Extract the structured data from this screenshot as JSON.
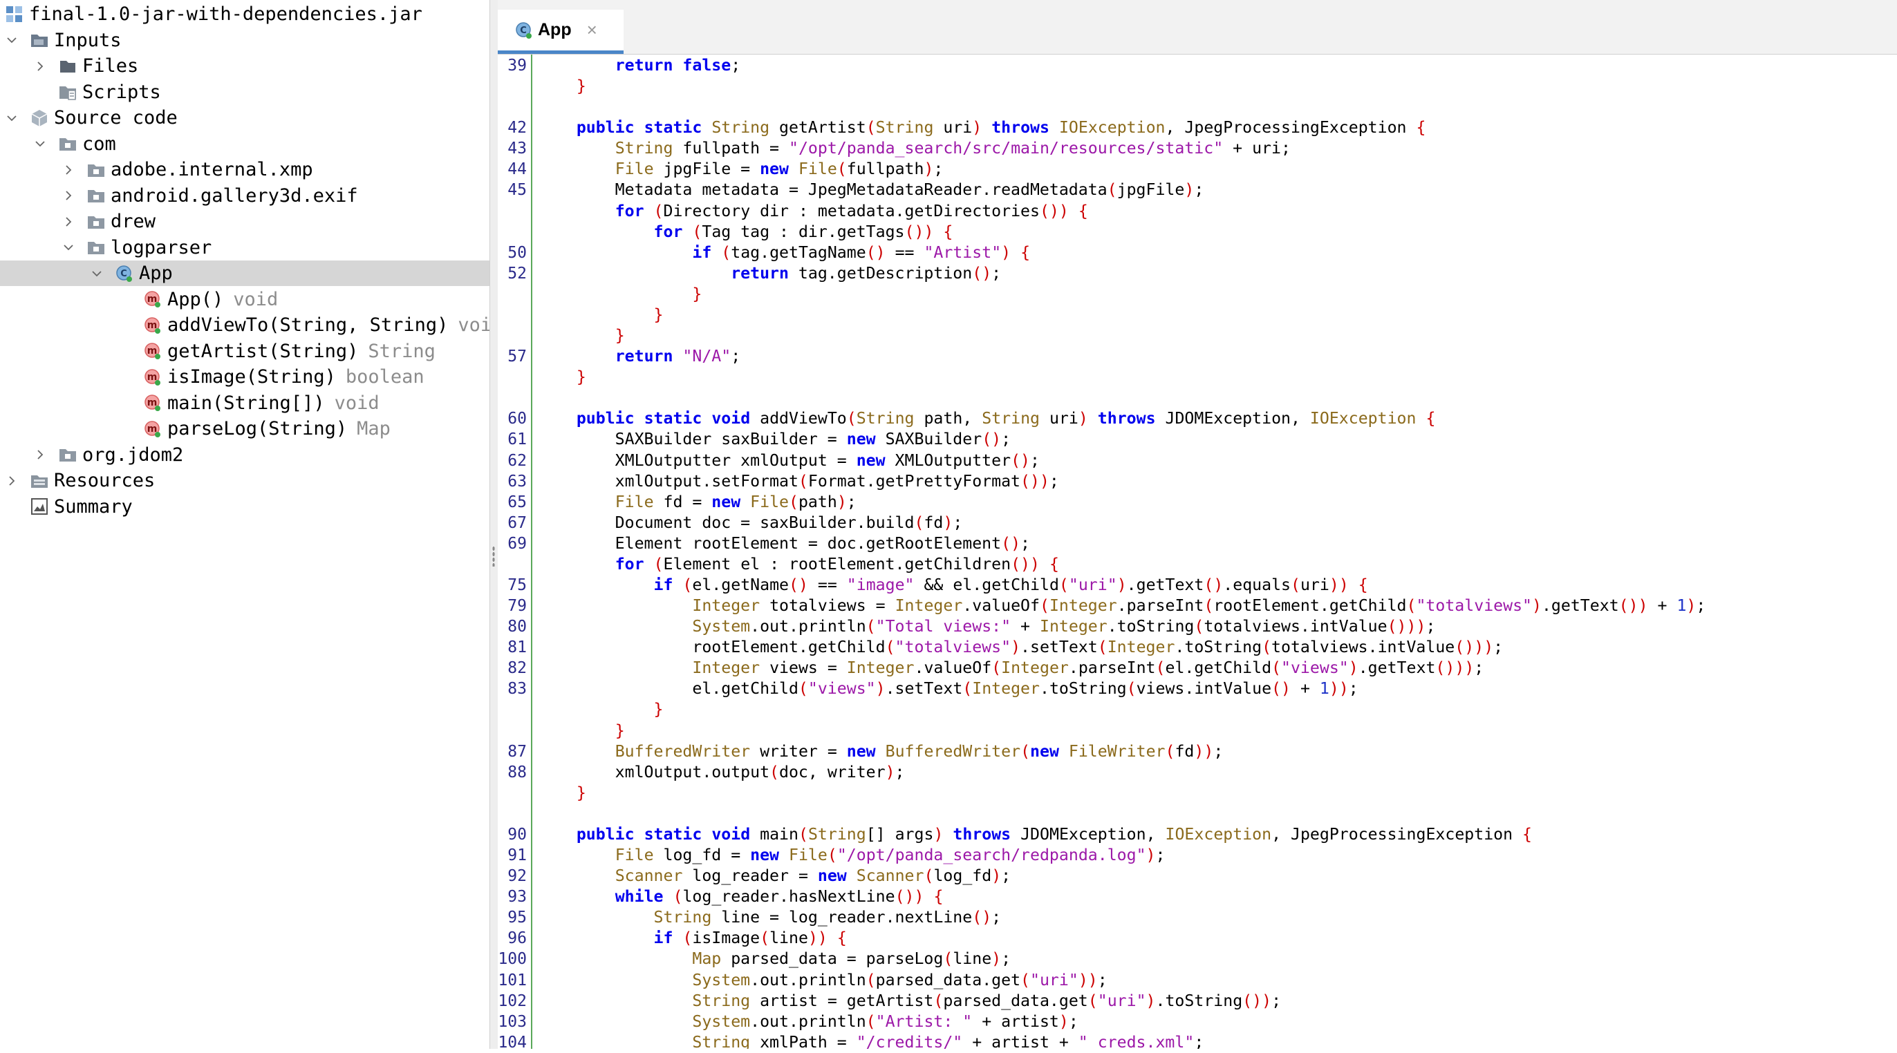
{
  "tree": {
    "rows": [
      {
        "label": "final-1.0-jar-with-dependencies.jar",
        "type": "",
        "icon": "jar-icon",
        "chevron": "none",
        "depth": 0
      },
      {
        "label": "Inputs",
        "type": "",
        "icon": "inputs-folder-icon",
        "chevron": "down",
        "depth": 0
      },
      {
        "label": "Files",
        "type": "",
        "icon": "folder-icon",
        "chevron": "right",
        "depth": 1
      },
      {
        "label": "Scripts",
        "type": "",
        "icon": "scripts-folder-icon",
        "chevron": "none",
        "depth": 1
      },
      {
        "label": "Source code",
        "type": "",
        "icon": "source-code-icon",
        "chevron": "down",
        "depth": 0
      },
      {
        "label": "com",
        "type": "",
        "icon": "package-icon",
        "chevron": "down",
        "depth": 1
      },
      {
        "label": "adobe.internal.xmp",
        "type": "",
        "icon": "package-icon",
        "chevron": "right",
        "depth": 2
      },
      {
        "label": "android.gallery3d.exif",
        "type": "",
        "icon": "package-icon",
        "chevron": "right",
        "depth": 2
      },
      {
        "label": "drew",
        "type": "",
        "icon": "package-icon",
        "chevron": "right",
        "depth": 2
      },
      {
        "label": "logparser",
        "type": "",
        "icon": "package-icon",
        "chevron": "down",
        "depth": 2
      },
      {
        "label": "App",
        "type": "",
        "icon": "class-icon",
        "chevron": "down",
        "depth": 3
      },
      {
        "label": "App()",
        "type": "void",
        "icon": "method-icon",
        "chevron": "none",
        "depth": 4
      },
      {
        "label": "addViewTo(String, String)",
        "type": "void",
        "icon": "method-icon",
        "chevron": "none",
        "depth": 4
      },
      {
        "label": "getArtist(String)",
        "type": "String",
        "icon": "method-icon",
        "chevron": "none",
        "depth": 4
      },
      {
        "label": "isImage(String)",
        "type": "boolean",
        "icon": "method-icon",
        "chevron": "none",
        "depth": 4
      },
      {
        "label": "main(String[])",
        "type": "void",
        "icon": "method-icon",
        "chevron": "none",
        "depth": 4
      },
      {
        "label": "parseLog(String)",
        "type": "Map",
        "icon": "method-icon",
        "chevron": "none",
        "depth": 4
      },
      {
        "label": "org.jdom2",
        "type": "",
        "icon": "package-icon",
        "chevron": "right",
        "depth": 1
      },
      {
        "label": "Resources",
        "type": "",
        "icon": "resources-folder-icon",
        "chevron": "right",
        "depth": 0
      },
      {
        "label": "Summary",
        "type": "",
        "icon": "summary-icon",
        "chevron": "none",
        "depth": 0
      }
    ],
    "selected_index": 10
  },
  "editor": {
    "tab": {
      "title": "App",
      "close": "×"
    },
    "lines": [
      {
        "n": "39",
        "t": "        return false;"
      },
      {
        "n": "",
        "t": "    }"
      },
      {
        "n": "",
        "t": ""
      },
      {
        "n": "42",
        "t": "    public static String getArtist(String uri) throws IOException, JpegProcessingException {"
      },
      {
        "n": "43",
        "t": "        String fullpath = \"/opt/panda_search/src/main/resources/static\" + uri;"
      },
      {
        "n": "44",
        "t": "        File jpgFile = new File(fullpath);"
      },
      {
        "n": "45",
        "t": "        Metadata metadata = JpegMetadataReader.readMetadata(jpgFile);"
      },
      {
        "n": "",
        "t": "        for (Directory dir : metadata.getDirectories()) {"
      },
      {
        "n": "",
        "t": "            for (Tag tag : dir.getTags()) {"
      },
      {
        "n": "50",
        "t": "                if (tag.getTagName() == \"Artist\") {"
      },
      {
        "n": "52",
        "t": "                    return tag.getDescription();"
      },
      {
        "n": "",
        "t": "                }"
      },
      {
        "n": "",
        "t": "            }"
      },
      {
        "n": "",
        "t": "        }"
      },
      {
        "n": "57",
        "t": "        return \"N/A\";"
      },
      {
        "n": "",
        "t": "    }"
      },
      {
        "n": "",
        "t": ""
      },
      {
        "n": "60",
        "t": "    public static void addViewTo(String path, String uri) throws JDOMException, IOException {"
      },
      {
        "n": "61",
        "t": "        SAXBuilder saxBuilder = new SAXBuilder();"
      },
      {
        "n": "62",
        "t": "        XMLOutputter xmlOutput = new XMLOutputter();"
      },
      {
        "n": "63",
        "t": "        xmlOutput.setFormat(Format.getPrettyFormat());"
      },
      {
        "n": "65",
        "t": "        File fd = new File(path);"
      },
      {
        "n": "67",
        "t": "        Document doc = saxBuilder.build(fd);"
      },
      {
        "n": "69",
        "t": "        Element rootElement = doc.getRootElement();"
      },
      {
        "n": "",
        "t": "        for (Element el : rootElement.getChildren()) {"
      },
      {
        "n": "75",
        "t": "            if (el.getName() == \"image\" && el.getChild(\"uri\").getText().equals(uri)) {"
      },
      {
        "n": "79",
        "t": "                Integer totalviews = Integer.valueOf(Integer.parseInt(rootElement.getChild(\"totalviews\").getText()) + 1);"
      },
      {
        "n": "80",
        "t": "                System.out.println(\"Total views:\" + Integer.toString(totalviews.intValue()));"
      },
      {
        "n": "81",
        "t": "                rootElement.getChild(\"totalviews\").setText(Integer.toString(totalviews.intValue()));"
      },
      {
        "n": "82",
        "t": "                Integer views = Integer.valueOf(Integer.parseInt(el.getChild(\"views\").getText()));"
      },
      {
        "n": "83",
        "t": "                el.getChild(\"views\").setText(Integer.toString(views.intValue() + 1));"
      },
      {
        "n": "",
        "t": "            }"
      },
      {
        "n": "",
        "t": "        }"
      },
      {
        "n": "87",
        "t": "        BufferedWriter writer = new BufferedWriter(new FileWriter(fd));"
      },
      {
        "n": "88",
        "t": "        xmlOutput.output(doc, writer);"
      },
      {
        "n": "",
        "t": "    }"
      },
      {
        "n": "",
        "t": ""
      },
      {
        "n": "90",
        "t": "    public static void main(String[] args) throws JDOMException, IOException, JpegProcessingException {"
      },
      {
        "n": "91",
        "t": "        File log_fd = new File(\"/opt/panda_search/redpanda.log\");"
      },
      {
        "n": "92",
        "t": "        Scanner log_reader = new Scanner(log_fd);"
      },
      {
        "n": "93",
        "t": "        while (log_reader.hasNextLine()) {"
      },
      {
        "n": "95",
        "t": "            String line = log_reader.nextLine();"
      },
      {
        "n": "96",
        "t": "            if (isImage(line)) {"
      },
      {
        "n": "100",
        "t": "                Map parsed_data = parseLog(line);"
      },
      {
        "n": "101",
        "t": "                System.out.println(parsed_data.get(\"uri\"));"
      },
      {
        "n": "102",
        "t": "                String artist = getArtist(parsed_data.get(\"uri\").toString());"
      },
      {
        "n": "103",
        "t": "                System.out.println(\"Artist: \" + artist);"
      },
      {
        "n": "104",
        "t": "                String xmlPath = \"/credits/\" + artist + \"_creds.xml\";"
      }
    ]
  },
  "colors": {
    "keyword": "#0000ee",
    "type": "#8b6a1c",
    "string": "#9c18a8",
    "brace": "#cc0000",
    "number": "#1e33c8",
    "line_number": "#2a2a8a",
    "gutter_border": "#5aa85a",
    "tab_accent": "#4a86c8",
    "selection": "#d6d6d6"
  }
}
